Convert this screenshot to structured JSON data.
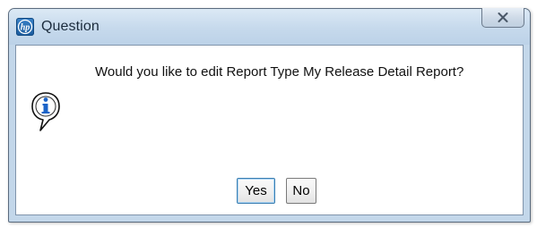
{
  "window": {
    "title": "Question",
    "app_icon": "hp-logo-icon",
    "close_icon": "close-icon"
  },
  "dialog": {
    "icon": "info-icon",
    "message": "Would you like to edit Report Type My Release Detail Report?"
  },
  "buttons": {
    "yes_label": "Yes",
    "no_label": "No"
  },
  "colors": {
    "titlebar": "#c6d9ec",
    "info_icon_blue": "#1c64c8",
    "default_button_border": "#3c7fb1"
  }
}
